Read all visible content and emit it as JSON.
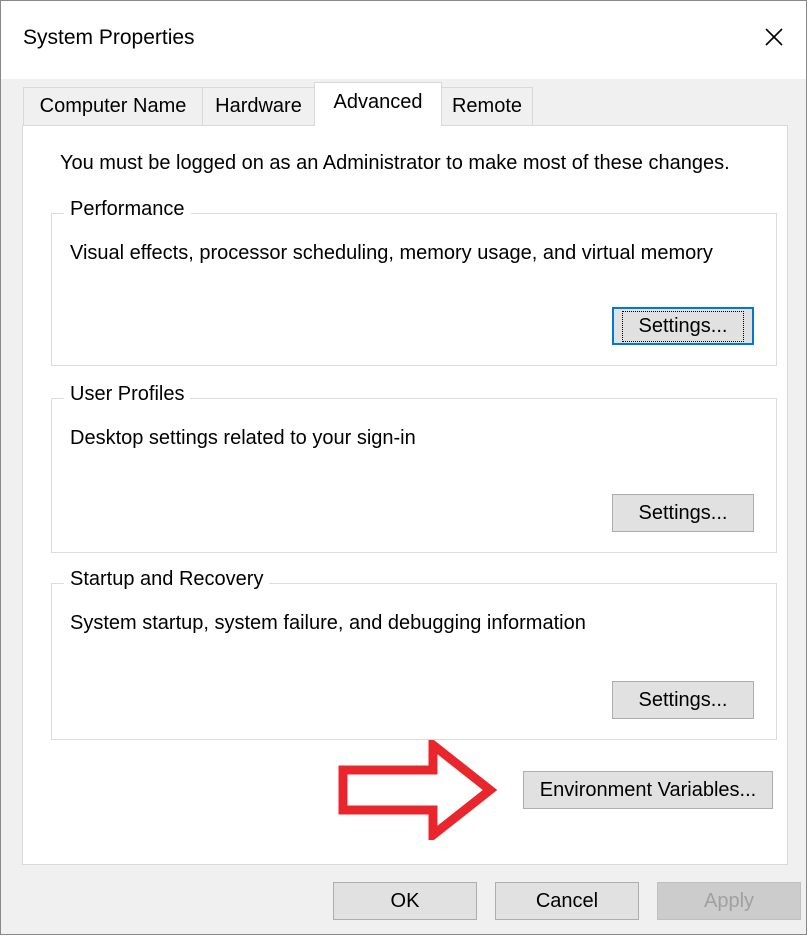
{
  "window": {
    "title": "System Properties",
    "close_icon": "close-icon"
  },
  "tabs": [
    {
      "label": "Computer Name",
      "active": false
    },
    {
      "label": "Hardware",
      "active": false
    },
    {
      "label": "Advanced",
      "active": true
    },
    {
      "label": "Remote",
      "active": false
    }
  ],
  "advanced": {
    "admin_note": "You must be logged on as an Administrator to make most of these changes.",
    "performance": {
      "legend": "Performance",
      "description": "Visual effects, processor scheduling, memory usage, and virtual memory",
      "button": "Settings..."
    },
    "user_profiles": {
      "legend": "User Profiles",
      "description": "Desktop settings related to your sign-in",
      "button": "Settings..."
    },
    "startup_recovery": {
      "legend": "Startup and Recovery",
      "description": "System startup, system failure, and debugging information",
      "button": "Settings..."
    },
    "environment_button": "Environment Variables...",
    "annotation_arrow_color": "#e8262b"
  },
  "footer": {
    "ok": "OK",
    "cancel": "Cancel",
    "apply": "Apply"
  }
}
